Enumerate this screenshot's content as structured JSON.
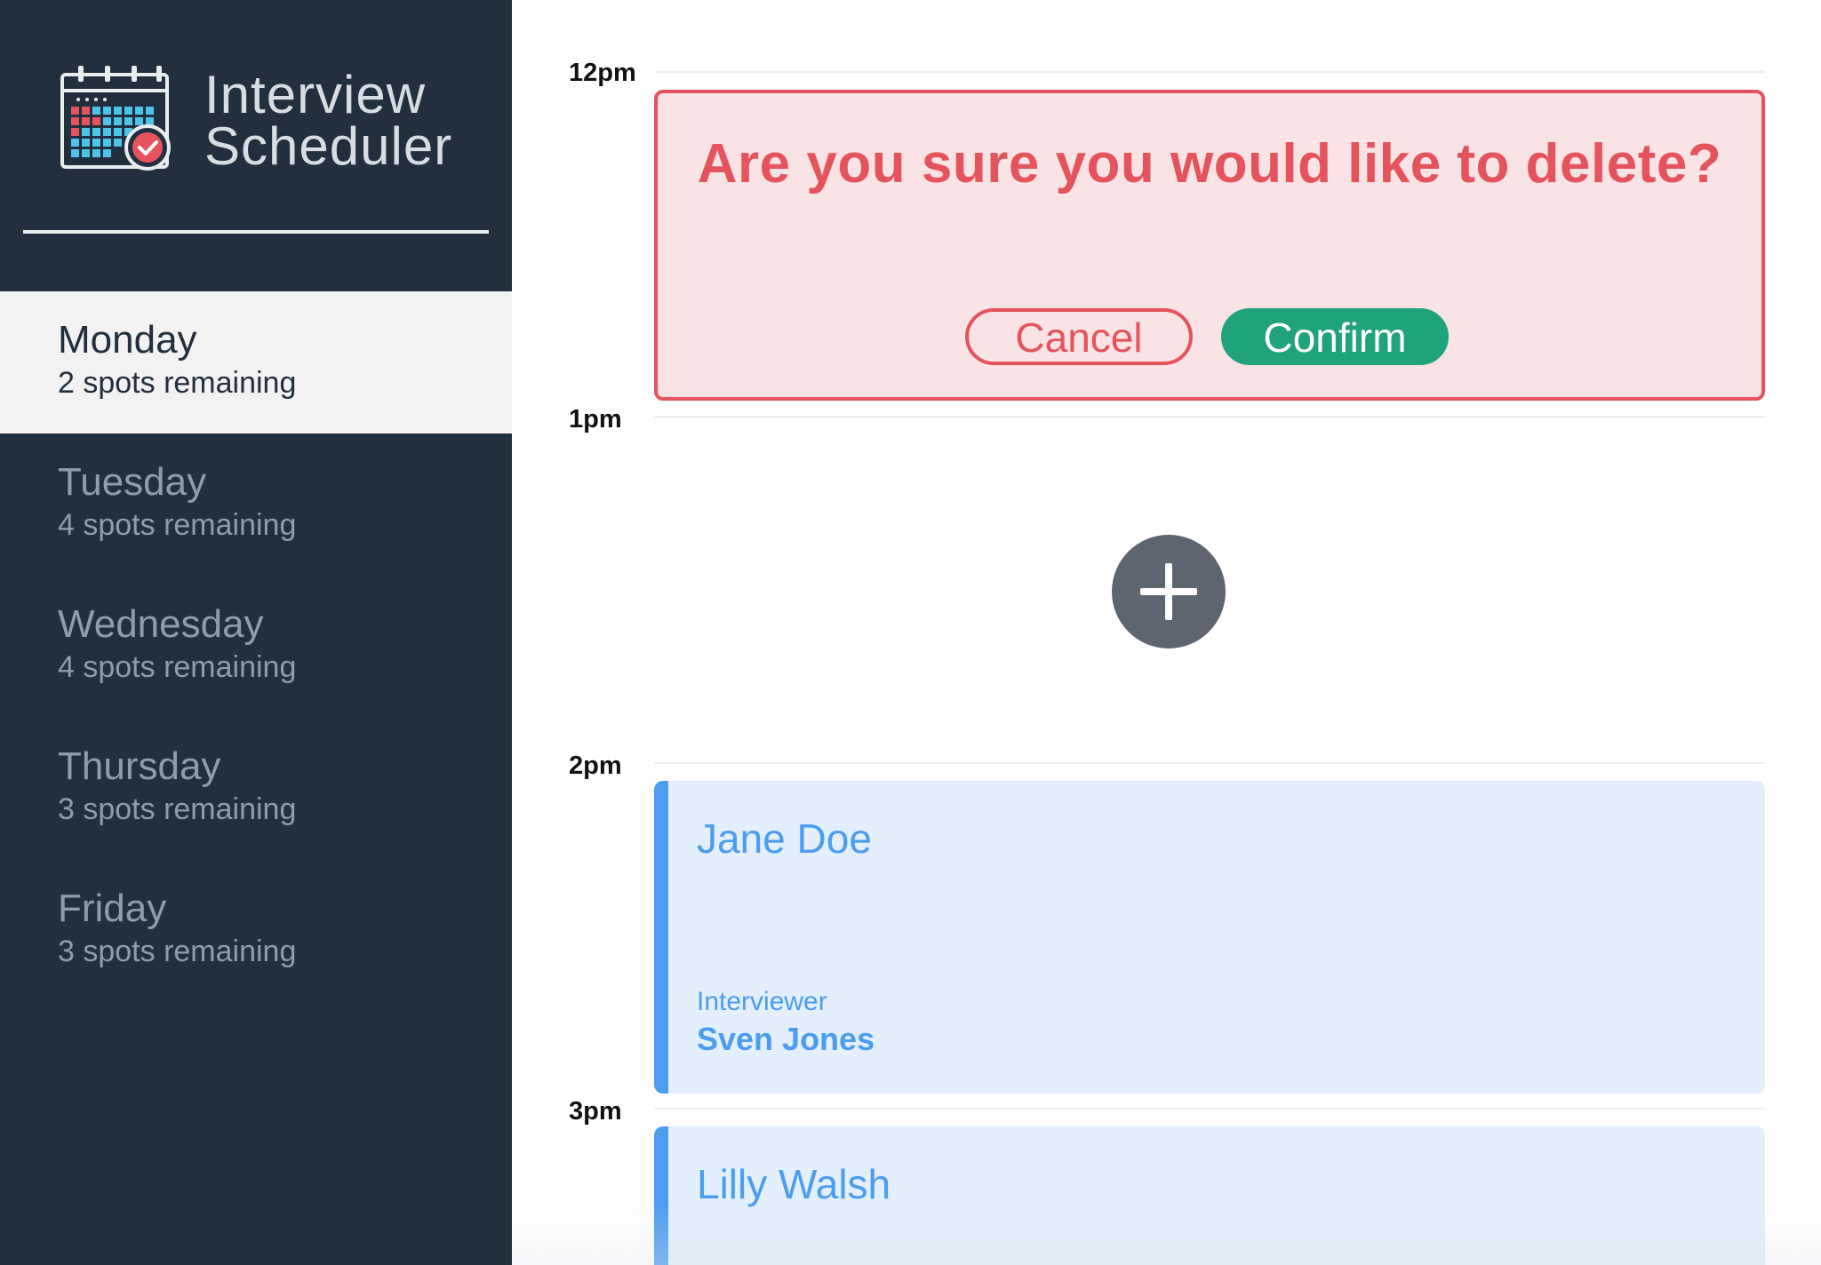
{
  "brand": {
    "title_line1": "Interview",
    "title_line2": "Scheduler",
    "logo_icon": "calendar-check-icon"
  },
  "sidebar": {
    "days": [
      {
        "name": "Monday",
        "spots": "2 spots remaining",
        "selected": true
      },
      {
        "name": "Tuesday",
        "spots": "4 spots remaining",
        "selected": false
      },
      {
        "name": "Wednesday",
        "spots": "4 spots remaining",
        "selected": false
      },
      {
        "name": "Thursday",
        "spots": "3 spots remaining",
        "selected": false
      },
      {
        "name": "Friday",
        "spots": "3 spots remaining",
        "selected": false
      }
    ]
  },
  "schedule": {
    "times": [
      "12pm",
      "1pm",
      "2pm",
      "3pm"
    ],
    "confirm": {
      "message": "Are you sure you would like to delete?",
      "cancel_label": "Cancel",
      "confirm_label": "Confirm"
    },
    "add_icon": "plus-icon",
    "appointments": [
      {
        "student": "Jane Doe",
        "interviewer_label": "Interviewer",
        "interviewer": "Sven Jones"
      },
      {
        "student": "Lilly Walsh"
      }
    ]
  },
  "colors": {
    "sidebar_bg": "#222f3e",
    "danger": "#e5545d",
    "danger_bg": "#fae3e5",
    "confirm_green": "#20a27a",
    "appointment_blue": "#4b9df0",
    "appointment_bg": "#e3effc",
    "add_button": "#5e6571"
  }
}
